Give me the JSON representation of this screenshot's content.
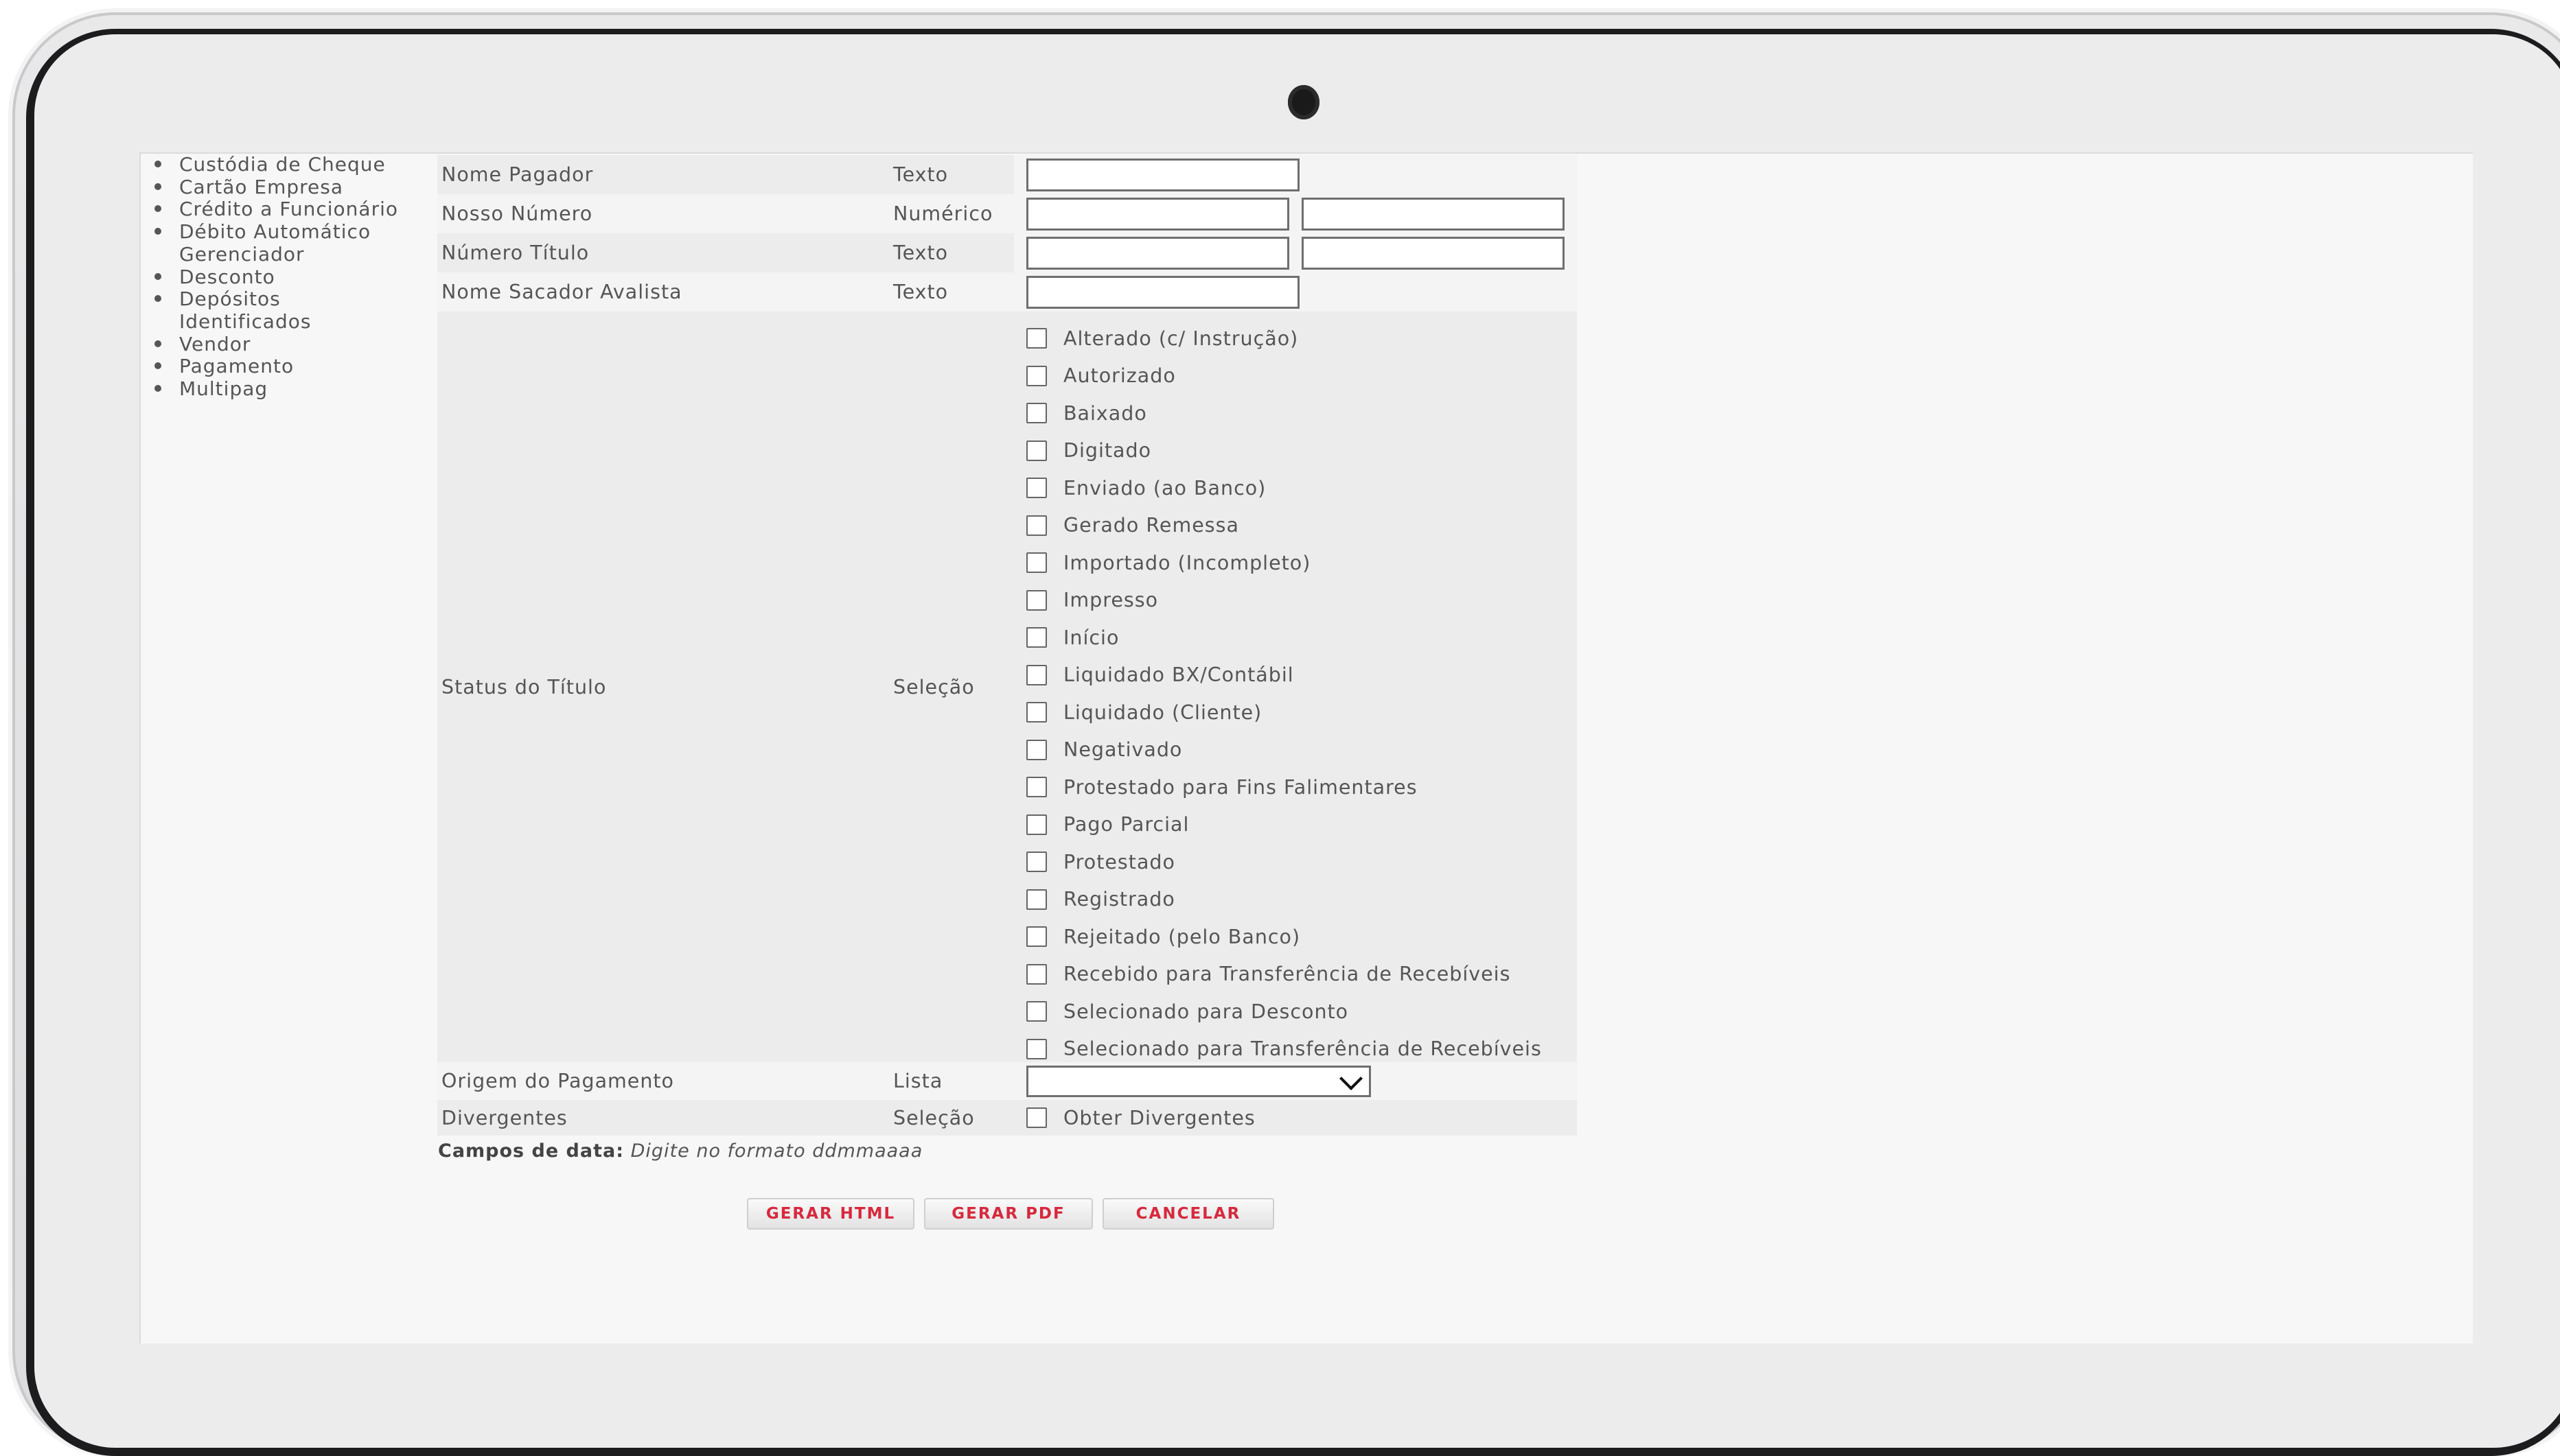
{
  "sidebar": {
    "items": [
      {
        "label": "Custódia de Cheque"
      },
      {
        "label": "Cartão Empresa"
      },
      {
        "label": "Crédito a Funcionário"
      },
      {
        "label": "Débito Automático",
        "sub": "Gerenciador"
      },
      {
        "label": "Desconto"
      },
      {
        "label": "Depósitos",
        "sub": "Identificados"
      },
      {
        "label": "Vendor"
      },
      {
        "label": "Pagamento"
      },
      {
        "label": "Multipag"
      }
    ]
  },
  "form": {
    "rows": [
      {
        "label": "Nome Pagador",
        "type": "Texto"
      },
      {
        "label": "Nosso Número",
        "type": "Numérico"
      },
      {
        "label": "Número Título",
        "type": "Texto"
      },
      {
        "label": "Nome Sacador Avalista",
        "type": "Texto"
      }
    ],
    "status": {
      "label": "Status do Título",
      "type": "Seleção",
      "options": [
        "Alterado (c/ Instrução)",
        "Autorizado",
        "Baixado",
        "Digitado",
        "Enviado (ao Banco)",
        "Gerado Remessa",
        "Importado (Incompleto)",
        "Impresso",
        "Início",
        "Liquidado BX/Contábil",
        "Liquidado (Cliente)",
        "Negativado",
        "Protestado para Fins Falimentares",
        "Pago Parcial",
        "Protestado",
        "Registrado",
        "Rejeitado (pelo Banco)",
        "Recebido para Transferência de Recebíveis",
        "Selecionado para Desconto",
        "Selecionado para Transferência de Recebíveis"
      ]
    },
    "origem": {
      "label": "Origem do Pagamento",
      "type": "Lista",
      "value": ""
    },
    "divergentes": {
      "label": "Divergentes",
      "type": "Seleção",
      "option": "Obter Divergentes"
    }
  },
  "note": {
    "bold": "Campos de data:",
    "italic": "Digite no formato ddmmaaaa"
  },
  "buttons": {
    "html": "GERAR HTML",
    "pdf": "GERAR PDF",
    "cancel": "CANCELAR"
  },
  "icons": {
    "select": "chevron-down-icon",
    "bullet": "bullet-icon",
    "camera": "camera-icon"
  },
  "colors": {
    "button_text": "#d8283c",
    "label_text": "#555555",
    "row_shade": "#ececec"
  }
}
